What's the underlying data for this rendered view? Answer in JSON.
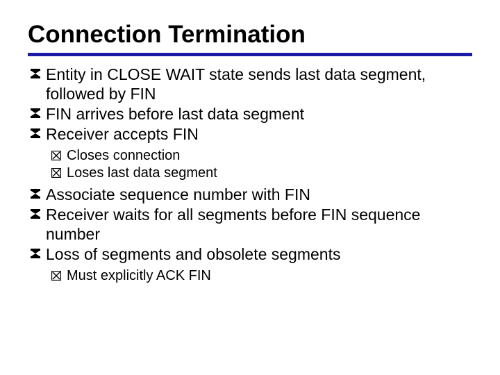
{
  "title": "Connection Termination",
  "bullets": {
    "a1": "Entity in CLOSE WAIT state sends last data segment, followed by FIN",
    "a2": "FIN arrives before last data segment",
    "a3": "Receiver accepts FIN",
    "a3_1": "Closes connection",
    "a3_2": "Loses last data segment",
    "a4": "Associate sequence number with FIN",
    "a5": "Receiver waits for all segments before FIN sequence number",
    "a6": "Loss of segments and obsolete segments",
    "a6_1": "Must explicitly ACK FIN"
  }
}
